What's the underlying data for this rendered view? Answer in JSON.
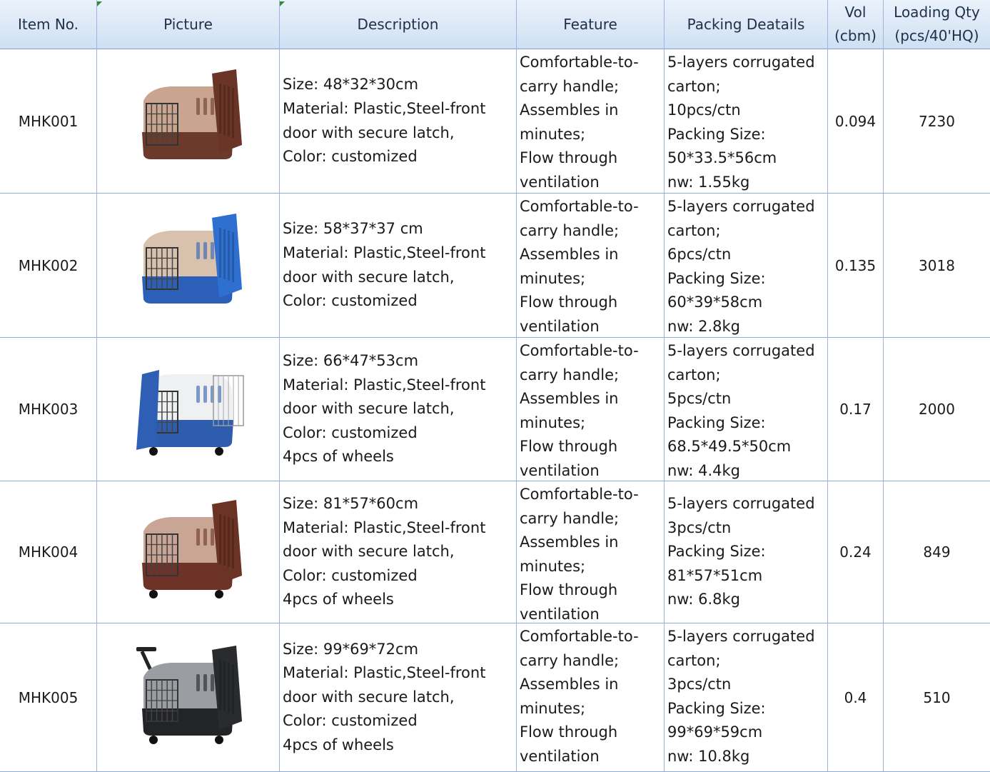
{
  "header": {
    "item_no": "Item No.",
    "picture": "Picture",
    "description": "Description",
    "feature": "Feature",
    "packing": "Packing Deatails",
    "vol_line1": "Vol",
    "vol_line2": "(cbm)",
    "qty_line1": "Loading Qty",
    "qty_line2": "(pcs/40'HQ)"
  },
  "rows": [
    {
      "item": "MHK001",
      "picture_icon": "pet-carrier-brown-icon",
      "colors": {
        "body": "#c9a48e",
        "base": "#6b3a2a",
        "door": "#6a3526"
      },
      "description": [
        "Size: 48*32*30cm",
        "Material: Plastic,Steel-front",
        "door with secure latch,",
        "Color: customized"
      ],
      "feature": [
        "Comfortable-to-",
        "carry handle;",
        "Assembles in",
        "minutes;",
        "Flow through",
        "ventilation"
      ],
      "packing": [
        "5-layers corrugated",
        "carton;",
        "10pcs/ctn",
        "Packing Size:",
        "50*33.5*56cm",
        "nw: 1.55kg"
      ],
      "vol": "0.094",
      "qty": "7230"
    },
    {
      "item": "MHK002",
      "picture_icon": "pet-carrier-blue-icon",
      "colors": {
        "body": "#d8c2ad",
        "base": "#2b5fb8",
        "door": "#2f6fd0"
      },
      "description": [
        "Size: 58*37*37 cm",
        "Material: Plastic,Steel-front",
        "door with secure latch,",
        "Color: customized"
      ],
      "feature": [
        "Comfortable-to-",
        "carry handle;",
        "Assembles in",
        "minutes;",
        "Flow through",
        "ventilation"
      ],
      "packing": [
        "5-layers corrugated",
        "carton;",
        "6pcs/ctn",
        "Packing Size:",
        "60*39*58cm",
        "nw: 2.8kg"
      ],
      "vol": "0.135",
      "qty": "3018"
    },
    {
      "item": "MHK003",
      "picture_icon": "pet-carrier-white-blue-icon",
      "colors": {
        "body": "#eef0f2",
        "base": "#2f5dae",
        "door": "#2e5fb4"
      },
      "description": [
        "Size: 66*47*53cm",
        "Material: Plastic,Steel-front",
        "door with secure latch,",
        "Color: customized",
        "4pcs of wheels"
      ],
      "feature": [
        "Comfortable-to-",
        "carry handle;",
        "Assembles in",
        "minutes;",
        "Flow through",
        "ventilation"
      ],
      "packing": [
        "5-layers corrugated",
        "carton;",
        "5pcs/ctn",
        "Packing Size:",
        "68.5*49.5*50cm",
        "nw: 4.4kg"
      ],
      "vol": "0.17",
      "qty": "2000"
    },
    {
      "item": "MHK004",
      "picture_icon": "pet-carrier-brown-wheels-icon",
      "colors": {
        "body": "#c8a594",
        "base": "#6e3326",
        "door": "#6b3324"
      },
      "description": [
        "Size: 81*57*60cm",
        "Material: Plastic,Steel-front",
        "door with secure latch,",
        "Color: customized",
        "4pcs of wheels"
      ],
      "feature": [
        "Comfortable-to-",
        "carry handle;",
        "Assembles in",
        "minutes;",
        "Flow through",
        "ventilation"
      ],
      "packing": [
        "5-layers corrugated",
        "3pcs/ctn",
        "Packing Size:",
        "81*57*51cm",
        "nw: 6.8kg"
      ],
      "vol": "0.24",
      "qty": "849"
    },
    {
      "item": "MHK005",
      "picture_icon": "pet-carrier-black-wheels-icon",
      "colors": {
        "body": "#9a9da2",
        "base": "#222428",
        "door": "#2a2b2e"
      },
      "description": [
        "Size: 99*69*72cm",
        "Material: Plastic,Steel-front",
        "door with secure latch,",
        "Color: customized",
        "4pcs of wheels"
      ],
      "feature": [
        "Comfortable-to-",
        "carry handle;",
        "Assembles in",
        "minutes;",
        "Flow through",
        "ventilation"
      ],
      "packing": [
        "5-layers corrugated",
        "carton;",
        "3pcs/ctn",
        "Packing Size:",
        "99*69*59cm",
        "nw: 10.8kg"
      ],
      "vol": "0.4",
      "qty": "510"
    }
  ]
}
